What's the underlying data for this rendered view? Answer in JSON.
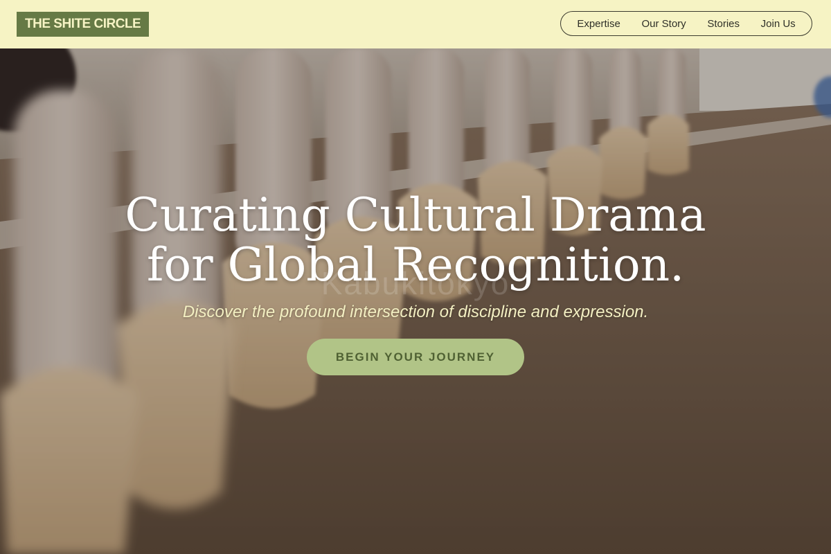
{
  "brand": {
    "logo_text": "THE SHITE CIRCLE"
  },
  "nav": {
    "items": [
      {
        "label": "Expertise"
      },
      {
        "label": "Our Story"
      },
      {
        "label": "Stories"
      },
      {
        "label": "Join Us"
      }
    ]
  },
  "hero": {
    "title_line1": "Curating Cultural Drama",
    "title_line2": "for Global Recognition.",
    "watermark": "Kabukitokyo",
    "subtitle": "Discover the profound intersection of discipline and expression.",
    "cta_label": "BEGIN YOUR JOURNEY",
    "image_description": "ballet-dancers-en-pointe-row"
  },
  "colors": {
    "header_bg": "#f6f3c4",
    "logo_bg": "#667a45",
    "cta_bg": "#b1c487",
    "cta_text": "#4f6133",
    "subtitle_text": "#f3efc2"
  }
}
